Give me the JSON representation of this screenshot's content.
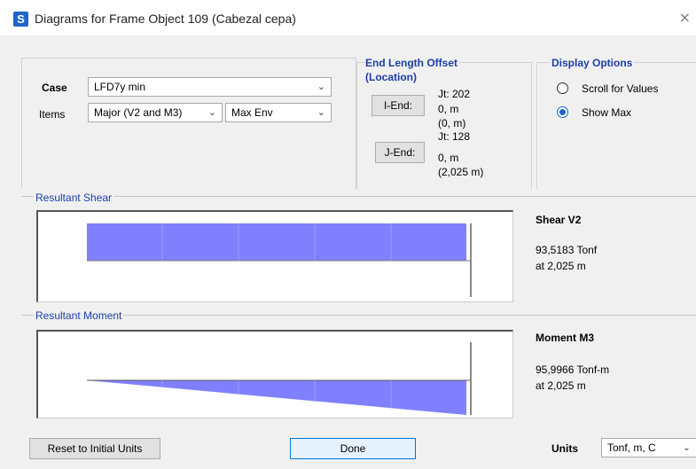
{
  "window": {
    "title": "Diagrams for Frame Object 109  (Cabezal cepa)",
    "app_icon_letter": "S",
    "close_glyph": "×"
  },
  "case": {
    "label": "Case",
    "value": "LFD7y min"
  },
  "items": {
    "label": "Items",
    "value": "Major (V2 and M3)",
    "env_value": "Max Env"
  },
  "end_length_offset": {
    "title_line1": "End Length Offset",
    "title_line2": "(Location)",
    "i_end": {
      "button": "I-End:",
      "jt": "Jt:  202",
      "offset": "0, m",
      "location": "(0, m)"
    },
    "j_end": {
      "button": "J-End:",
      "jt": "Jt:  128",
      "offset": "0, m",
      "location": "(2,025 m)"
    }
  },
  "display_options": {
    "title": "Display Options",
    "options": [
      {
        "label": "Scroll for Values",
        "checked": false
      },
      {
        "label": "Show Max",
        "checked": true
      }
    ]
  },
  "shear": {
    "section_label": "Resultant Shear",
    "title": "Shear V2",
    "value": "93,5183 Tonf",
    "location": "at 2,025 m"
  },
  "moment": {
    "section_label": "Resultant Moment",
    "title": "Moment M3",
    "value": "95,9966 Tonf-m",
    "location": "at 2,025 m"
  },
  "footer": {
    "reset_label": "Reset to Initial Units",
    "done_label": "Done",
    "units_label": "Units",
    "units_value": "Tonf, m, C"
  },
  "colors": {
    "diagram_fill": "#8080ff",
    "accent_blue": "#1c3fa8"
  }
}
